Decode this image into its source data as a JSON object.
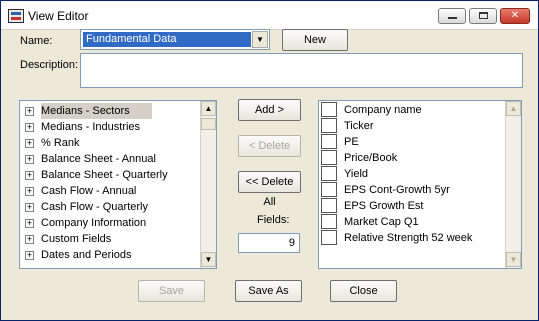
{
  "window": {
    "title": "View Editor"
  },
  "form": {
    "name_label": "Name:",
    "name_value": "Fundamental Data",
    "new_button": "New",
    "description_label": "Description:",
    "description_value": ""
  },
  "categories": [
    {
      "label": "Medians - Sectors",
      "selected": true
    },
    {
      "label": "Medians - Industries"
    },
    {
      "label": "% Rank"
    },
    {
      "label": "Balance Sheet - Annual"
    },
    {
      "label": "Balance Sheet - Quarterly"
    },
    {
      "label": "Cash Flow - Annual"
    },
    {
      "label": "Cash Flow - Quarterly"
    },
    {
      "label": "Company Information"
    },
    {
      "label": "Custom Fields"
    },
    {
      "label": "Dates and Periods"
    }
  ],
  "actions": {
    "add": "Add >",
    "delete": "< Delete",
    "delete_all": "<< Delete All",
    "fields_label": "Fields:",
    "fields_count": "9"
  },
  "selected_fields": [
    "Company name",
    "Ticker",
    "PE",
    "Price/Book",
    "Yield",
    "EPS Cont-Growth 5yr",
    "EPS Growth Est",
    "Market Cap Q1",
    "Relative Strength 52 week"
  ],
  "footer": {
    "save": "Save",
    "save_as": "Save As",
    "close": "Close"
  }
}
